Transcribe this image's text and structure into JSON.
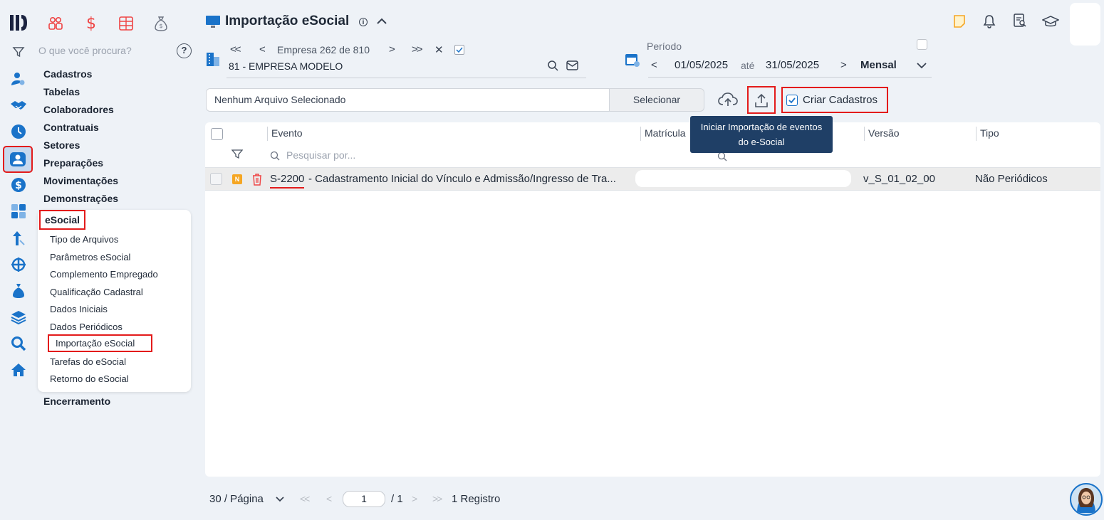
{
  "search": {
    "placeholder": "O que você procura?"
  },
  "menu": {
    "items": [
      "Cadastros",
      "Tabelas",
      "Colaboradores",
      "Contratuais",
      "Setores",
      "Preparações",
      "Movimentações",
      "Demonstrações"
    ],
    "esocial": {
      "label": "eSocial",
      "items": [
        "Tipo de Arquivos",
        "Parâmetros eSocial",
        "Complemento Empregado",
        "Qualificação Cadastral",
        "Dados Iniciais",
        "Dados Periódicos",
        "Importação eSocial",
        "Tarefas do eSocial",
        "Retorno do eSocial"
      ]
    },
    "after": "Encerramento"
  },
  "header": {
    "title": "Importação eSocial"
  },
  "company": {
    "nav": "Empresa 262 de 810",
    "name": "81 - EMPRESA MODELO"
  },
  "period": {
    "label": "Período",
    "start": "01/05/2025",
    "sep": "até",
    "end": "31/05/2025",
    "mode": "Mensal"
  },
  "file": {
    "value": "Nenhum Arquivo Selecionado",
    "button": "Selecionar",
    "create_label": "Criar Cadastros",
    "create_checked": true
  },
  "tooltip": {
    "line1": "Iniciar Importação de eventos",
    "line2": "do e-Social"
  },
  "table": {
    "columns": {
      "evento": "Evento",
      "matricula": "Matrícula",
      "versao": "Versão",
      "tipo": "Tipo"
    },
    "filter_placeholder": "Pesquisar por...",
    "rows": [
      {
        "badge": "N",
        "code": "S-2200",
        "desc": "- Cadastramento Inicial do Vínculo e Admissão/Ingresso de Tra...",
        "versao": "v_S_01_02_00",
        "tipo": "Não Periódicos"
      }
    ]
  },
  "pager": {
    "per_page": "30 / Página",
    "page": "1",
    "total_pages": "/ 1",
    "records": "1 Registro"
  },
  "colors": {
    "accent": "#1a73c9",
    "red": "#e31b1b",
    "badge": "#f5a623",
    "tooltip": "#1f3f66"
  }
}
